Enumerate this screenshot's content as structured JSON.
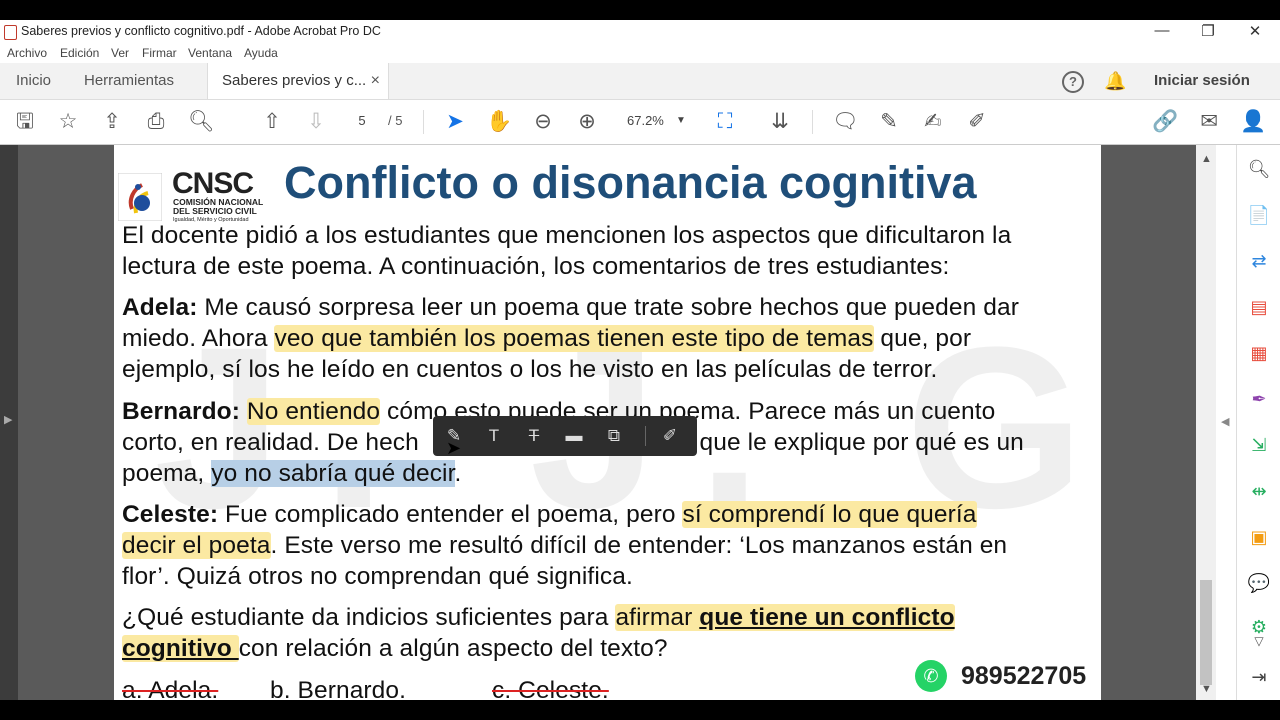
{
  "window": {
    "title": "Saberes previos y conflicto cognitivo.pdf - Adobe Acrobat Pro DC",
    "minimize": "—",
    "restore": "❐",
    "close": "✕"
  },
  "menu": [
    "Archivo",
    "Edición",
    "Ver",
    "Firmar",
    "Ventana",
    "Ayuda"
  ],
  "tabs": {
    "home": "Inicio",
    "tools": "Herramientas",
    "doc": "Saberes previos y c...",
    "doc_close": "×",
    "signin": "Iniciar sesión",
    "help": "?"
  },
  "toolbar": {
    "page_current": "5",
    "page_total": "/ 5",
    "zoom": "67.2%"
  },
  "logo": {
    "acronym": "CNSC",
    "line1": "COMISIÓN NACIONAL",
    "line2": "DEL SERVICIO CIVIL",
    "tagline": "Igualdad, Mérito y Oportunidad"
  },
  "document": {
    "heading": "Conflicto o disonancia cognitiva",
    "intro1": "El docente pidió a los estudiantes que mencionen los aspectos que dificultaron la",
    "intro2": "lectura de este poema. A continuación, los comentarios de tres estudiantes:",
    "adela_name": "Adela:",
    "adela_1a": " Me causó sorpresa leer un poema que trate sobre hechos que pueden dar",
    "adela_2a": "miedo. Ahora ",
    "adela_2hl": "veo que también los poemas tienen este tipo de temas",
    "adela_2b": " que, por",
    "adela_3": "ejemplo, sí los he leído en cuentos o los he visto en las películas de terror.",
    "bernardo_name": "Bernardo:",
    "bernardo_1hl": "No entiendo",
    "bernardo_1b": " cómo esto puede ser un poema. Parece más un cuento",
    "bernardo_2a": "corto, en realidad. De hech",
    "bernardo_2b": "a que le explique por qué es un",
    "bernardo_3a": "poema, ",
    "bernardo_3hl": "yo no sabría qué decir",
    "bernardo_3b": ".",
    "celeste_name": "Celeste:",
    "celeste_1a": " Fue complicado entender el poema, pero ",
    "celeste_1hl": "sí comprendí lo que quería",
    "celeste_2hl": "decir el poeta",
    "celeste_2b": ". Este verso me resultó difícil de entender: ‘Los manzanos están en",
    "celeste_3": "flor’. Quizá otros no comprendan qué significa.",
    "question_1a": "¿Qué estudiante da indicios suficientes para ",
    "question_1hl": "afirmar ",
    "question_1u": "que tiene un conflicto",
    "question_2u": "cognitivo ",
    "question_2b": "con relación a algún aspecto del texto?",
    "option_a": "a.  Adela.",
    "option_b": "b. Bernardo.",
    "option_c": "c.  Celeste.",
    "phone": "989522705",
    "watermark": "J. J. G. G."
  },
  "icons": {
    "save": "save-icon",
    "bookmark": "star-icon",
    "upload": "cloud-upload-icon",
    "print": "printer-icon",
    "find": "search-icon",
    "prev": "arrow-up-icon",
    "next": "arrow-down-icon",
    "select": "cursor-icon",
    "hand": "hand-icon",
    "zoom_out": "zoom-out-icon",
    "zoom_in": "zoom-in-icon"
  },
  "colors": {
    "highlight_yellow": "#fbe9a2",
    "highlight_blue": "#b7cfe6",
    "heading_blue": "#1f4e79",
    "accent": "#1473e6"
  }
}
